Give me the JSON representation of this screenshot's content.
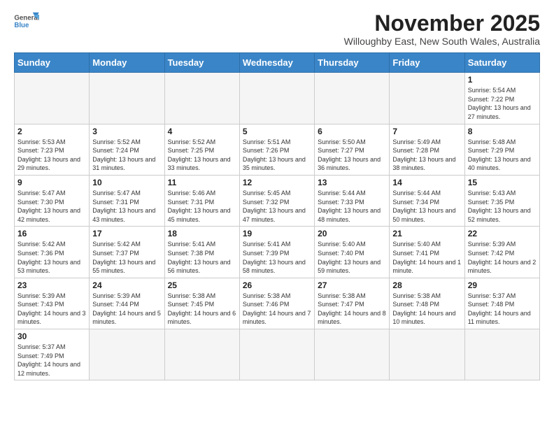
{
  "header": {
    "title": "November 2025",
    "subtitle": "Willoughby East, New South Wales, Australia"
  },
  "logo": {
    "line1": "General",
    "line2": "Blue"
  },
  "weekdays": [
    "Sunday",
    "Monday",
    "Tuesday",
    "Wednesday",
    "Thursday",
    "Friday",
    "Saturday"
  ],
  "weeks": [
    [
      {
        "day": "",
        "empty": true
      },
      {
        "day": "",
        "empty": true
      },
      {
        "day": "",
        "empty": true
      },
      {
        "day": "",
        "empty": true
      },
      {
        "day": "",
        "empty": true
      },
      {
        "day": "",
        "empty": true
      },
      {
        "day": "1",
        "sunrise": "5:54 AM",
        "sunset": "7:22 PM",
        "daylight": "13 hours and 27 minutes."
      }
    ],
    [
      {
        "day": "2",
        "sunrise": "5:53 AM",
        "sunset": "7:23 PM",
        "daylight": "13 hours and 29 minutes."
      },
      {
        "day": "3",
        "sunrise": "5:52 AM",
        "sunset": "7:24 PM",
        "daylight": "13 hours and 31 minutes."
      },
      {
        "day": "4",
        "sunrise": "5:52 AM",
        "sunset": "7:25 PM",
        "daylight": "13 hours and 33 minutes."
      },
      {
        "day": "5",
        "sunrise": "5:51 AM",
        "sunset": "7:26 PM",
        "daylight": "13 hours and 35 minutes."
      },
      {
        "day": "6",
        "sunrise": "5:50 AM",
        "sunset": "7:27 PM",
        "daylight": "13 hours and 36 minutes."
      },
      {
        "day": "7",
        "sunrise": "5:49 AM",
        "sunset": "7:28 PM",
        "daylight": "13 hours and 38 minutes."
      },
      {
        "day": "8",
        "sunrise": "5:48 AM",
        "sunset": "7:29 PM",
        "daylight": "13 hours and 40 minutes."
      }
    ],
    [
      {
        "day": "9",
        "sunrise": "5:47 AM",
        "sunset": "7:30 PM",
        "daylight": "13 hours and 42 minutes."
      },
      {
        "day": "10",
        "sunrise": "5:47 AM",
        "sunset": "7:31 PM",
        "daylight": "13 hours and 43 minutes."
      },
      {
        "day": "11",
        "sunrise": "5:46 AM",
        "sunset": "7:31 PM",
        "daylight": "13 hours and 45 minutes."
      },
      {
        "day": "12",
        "sunrise": "5:45 AM",
        "sunset": "7:32 PM",
        "daylight": "13 hours and 47 minutes."
      },
      {
        "day": "13",
        "sunrise": "5:44 AM",
        "sunset": "7:33 PM",
        "daylight": "13 hours and 48 minutes."
      },
      {
        "day": "14",
        "sunrise": "5:44 AM",
        "sunset": "7:34 PM",
        "daylight": "13 hours and 50 minutes."
      },
      {
        "day": "15",
        "sunrise": "5:43 AM",
        "sunset": "7:35 PM",
        "daylight": "13 hours and 52 minutes."
      }
    ],
    [
      {
        "day": "16",
        "sunrise": "5:42 AM",
        "sunset": "7:36 PM",
        "daylight": "13 hours and 53 minutes."
      },
      {
        "day": "17",
        "sunrise": "5:42 AM",
        "sunset": "7:37 PM",
        "daylight": "13 hours and 55 minutes."
      },
      {
        "day": "18",
        "sunrise": "5:41 AM",
        "sunset": "7:38 PM",
        "daylight": "13 hours and 56 minutes."
      },
      {
        "day": "19",
        "sunrise": "5:41 AM",
        "sunset": "7:39 PM",
        "daylight": "13 hours and 58 minutes."
      },
      {
        "day": "20",
        "sunrise": "5:40 AM",
        "sunset": "7:40 PM",
        "daylight": "13 hours and 59 minutes."
      },
      {
        "day": "21",
        "sunrise": "5:40 AM",
        "sunset": "7:41 PM",
        "daylight": "14 hours and 1 minute."
      },
      {
        "day": "22",
        "sunrise": "5:39 AM",
        "sunset": "7:42 PM",
        "daylight": "14 hours and 2 minutes."
      }
    ],
    [
      {
        "day": "23",
        "sunrise": "5:39 AM",
        "sunset": "7:43 PM",
        "daylight": "14 hours and 3 minutes."
      },
      {
        "day": "24",
        "sunrise": "5:39 AM",
        "sunset": "7:44 PM",
        "daylight": "14 hours and 5 minutes."
      },
      {
        "day": "25",
        "sunrise": "5:38 AM",
        "sunset": "7:45 PM",
        "daylight": "14 hours and 6 minutes."
      },
      {
        "day": "26",
        "sunrise": "5:38 AM",
        "sunset": "7:46 PM",
        "daylight": "14 hours and 7 minutes."
      },
      {
        "day": "27",
        "sunrise": "5:38 AM",
        "sunset": "7:47 PM",
        "daylight": "14 hours and 8 minutes."
      },
      {
        "day": "28",
        "sunrise": "5:38 AM",
        "sunset": "7:48 PM",
        "daylight": "14 hours and 10 minutes."
      },
      {
        "day": "29",
        "sunrise": "5:37 AM",
        "sunset": "7:48 PM",
        "daylight": "14 hours and 11 minutes."
      }
    ],
    [
      {
        "day": "30",
        "sunrise": "5:37 AM",
        "sunset": "7:49 PM",
        "daylight": "14 hours and 12 minutes."
      },
      {
        "day": "",
        "empty": true
      },
      {
        "day": "",
        "empty": true
      },
      {
        "day": "",
        "empty": true
      },
      {
        "day": "",
        "empty": true
      },
      {
        "day": "",
        "empty": true
      },
      {
        "day": "",
        "empty": true
      }
    ]
  ]
}
